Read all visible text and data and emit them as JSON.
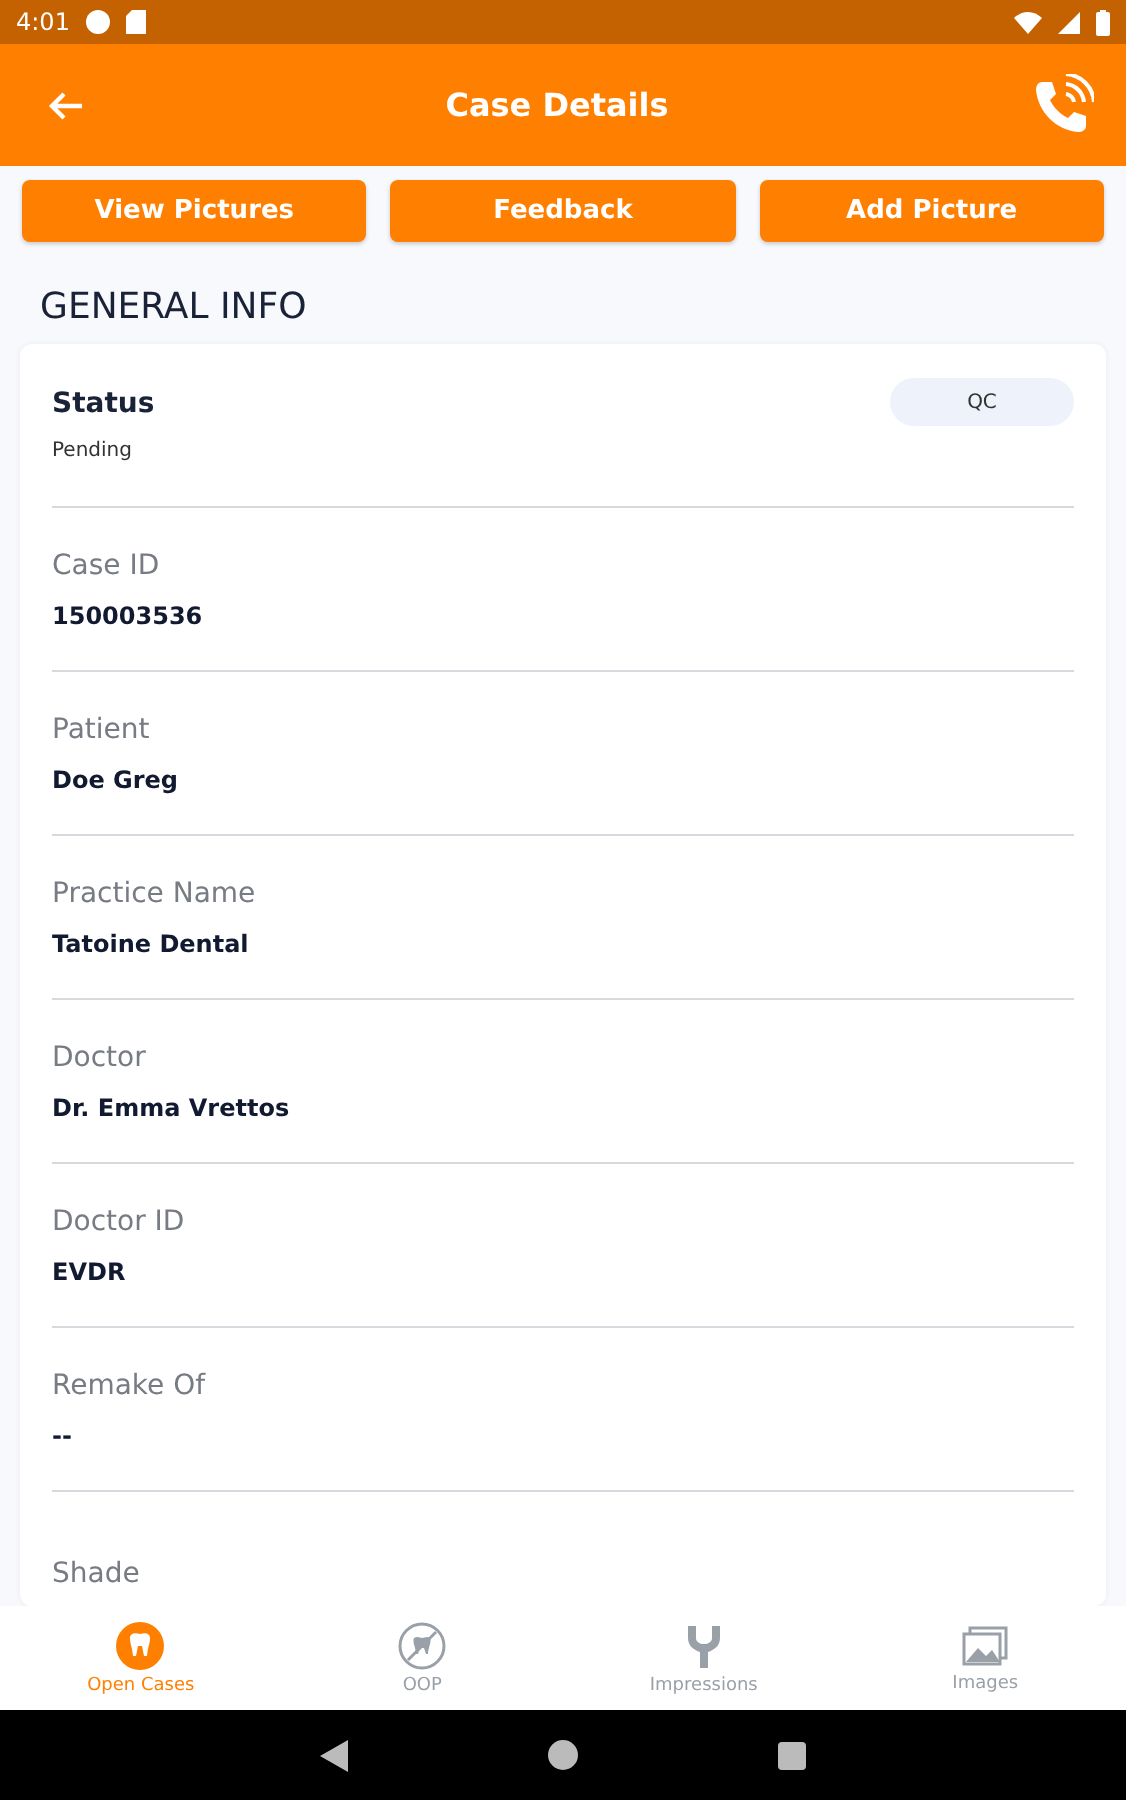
{
  "status_bar": {
    "time": "4:01"
  },
  "app_bar": {
    "title": "Case Details"
  },
  "actions": [
    "View Pictures",
    "Feedback",
    "Add Picture"
  ],
  "section_title": "GENERAL INFO",
  "status": {
    "label": "Status",
    "value": "Pending",
    "badge": "QC"
  },
  "fields": [
    {
      "label": "Case ID",
      "value": "150003536"
    },
    {
      "label": "Patient",
      "value": "Doe Greg"
    },
    {
      "label": "Practice Name",
      "value": "Tatoine Dental"
    },
    {
      "label": "Doctor",
      "value": "Dr. Emma Vrettos"
    },
    {
      "label": "Doctor ID",
      "value": "EVDR"
    },
    {
      "label": "Remake Of",
      "value": "--"
    },
    {
      "label": "Shade"
    }
  ],
  "nav": [
    {
      "label": "Open Cases",
      "kind": "tooth",
      "selected": true
    },
    {
      "label": "OOP",
      "kind": "oop",
      "selected": false
    },
    {
      "label": "Impressions",
      "kind": "fork",
      "selected": false
    },
    {
      "label": "Images",
      "kind": "images",
      "selected": false
    }
  ]
}
